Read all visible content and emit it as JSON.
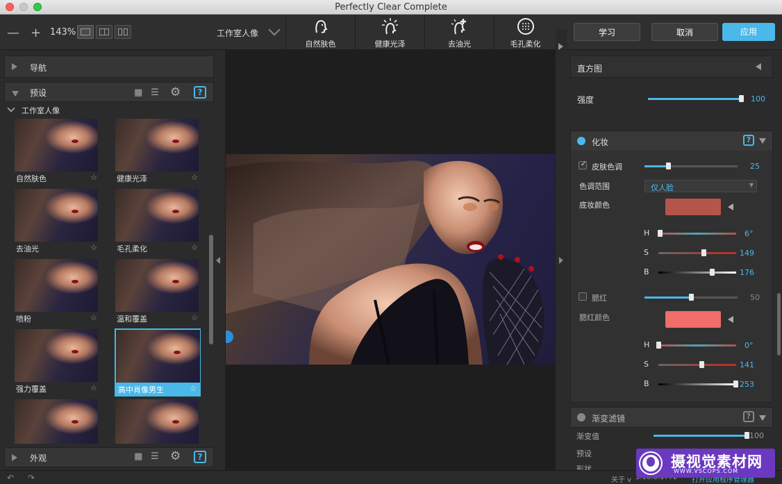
{
  "window": {
    "title": "Perfectly Clear Complete"
  },
  "toolbar": {
    "zoom_out": "—",
    "zoom_in": "+",
    "zoom_level": "143%",
    "preset_selected": "工作室人像",
    "tools": [
      {
        "label": "自然肤色",
        "icon": "face-natural-icon"
      },
      {
        "label": "健康光泽",
        "icon": "face-glow-icon"
      },
      {
        "label": "去油光",
        "icon": "face-shine-remove-icon"
      },
      {
        "label": "毛孔柔化",
        "icon": "pore-soften-icon"
      }
    ],
    "learn_label": "学习",
    "cancel_label": "取消",
    "apply_label": "应用",
    "accent": "#4ab8e8"
  },
  "left": {
    "nav_label": "导航",
    "presets_label": "预设",
    "group_label": "工作室人像",
    "thumbnails": [
      {
        "name": "自然肤色",
        "star": "☆"
      },
      {
        "name": "健康光泽",
        "star": "☆"
      },
      {
        "name": "去油光",
        "star": "☆"
      },
      {
        "name": "毛孔柔化",
        "star": "☆"
      },
      {
        "name": "喷粉",
        "star": "☆"
      },
      {
        "name": "温和覆盖",
        "star": "☆"
      },
      {
        "name": "强力覆盖",
        "star": "☆"
      },
      {
        "name": "高中肖像男生",
        "star": "☆"
      },
      {
        "name": "",
        "star": ""
      },
      {
        "name": "",
        "star": ""
      }
    ],
    "appearance_label": "外观",
    "help_label": "?"
  },
  "right": {
    "histogram_label": "直方图",
    "strength_label": "强度",
    "strength_value": "100",
    "strength_level": 1.0,
    "makeup_label": "化妆",
    "skin_tone_label": "皮肤色调",
    "skin_tone_value": "25",
    "skin_tone_level": 0.25,
    "tone_range_label": "色调范围",
    "tone_range_value": "仅人脸",
    "foundation_label": "底妆颜色",
    "foundation_color": "#b5554a",
    "foundation_h": "6°",
    "foundation_s": "149",
    "foundation_b": "176",
    "foundation_h_level": 0.02,
    "foundation_s_level": 0.58,
    "foundation_b_level": 0.69,
    "blush_label": "腮红",
    "blush_value": "50",
    "blush_level": 0.5,
    "blush_color_label": "腮红颜色",
    "blush_color": "#ef6d6a",
    "blush_h": "0°",
    "blush_s": "141",
    "blush_b": "253",
    "blush_h_level": 0.0,
    "blush_s_level": 0.55,
    "blush_b_level": 0.99,
    "h_label": "H",
    "s_label": "S",
    "b_label": "B",
    "gradient_filter_label": "渐变滤镜",
    "gradient_value_label": "渐变值",
    "gradient_value": "100",
    "preset_label": "预设",
    "shape_label": "形状"
  },
  "status": {
    "about": "关于 v",
    "version": "3.10.0.1772",
    "open_manager": "打开应用程序管理器"
  },
  "watermark": {
    "brand": "摄视觉素材网",
    "url": "WWW.VSCOPS.COM"
  }
}
